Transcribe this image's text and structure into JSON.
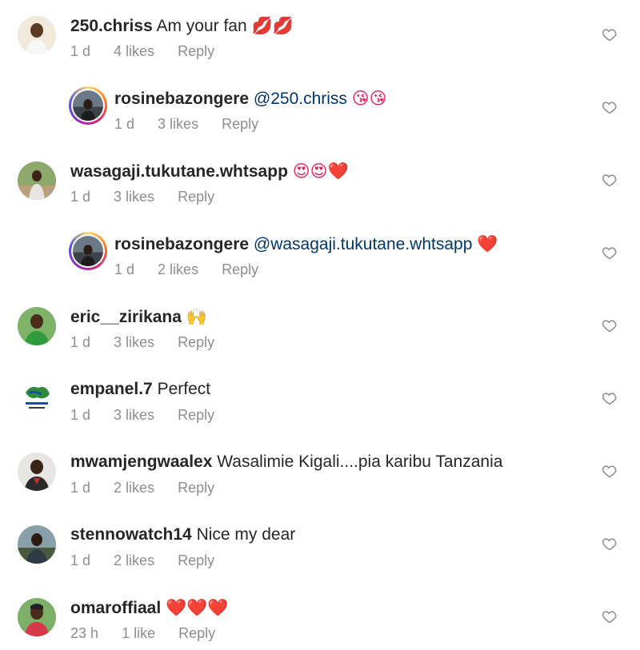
{
  "comments": [
    {
      "username": "250.chriss",
      "text": "Am your fan",
      "emoji": "💋💋",
      "time": "1 d",
      "likes": "4 likes",
      "reply": "Reply"
    },
    {
      "username": "rosinebazongere",
      "mention": "@250.chriss",
      "emoji": "😘😘",
      "time": "1 d",
      "likes": "3 likes",
      "reply": "Reply"
    },
    {
      "username": "wasagaji.tukutane.whtsapp",
      "emoji": "😍😍❤️",
      "time": "1 d",
      "likes": "3 likes",
      "reply": "Reply"
    },
    {
      "username": "rosinebazongere",
      "mention": "@wasagaji.tukutane.whtsapp",
      "emoji": "❤️",
      "time": "1 d",
      "likes": "2 likes",
      "reply": "Reply"
    },
    {
      "username": "eric__zirikana",
      "emoji": "🙌",
      "time": "1 d",
      "likes": "3 likes",
      "reply": "Reply"
    },
    {
      "username": "empanel.7",
      "text": "Perfect",
      "time": "1 d",
      "likes": "3 likes",
      "reply": "Reply"
    },
    {
      "username": "mwamjengwaalex",
      "text": "Wasalimie Kigali....pia karibu Tanzania",
      "time": "1 d",
      "likes": "2 likes",
      "reply": "Reply"
    },
    {
      "username": "stennowatch14",
      "text": "Nice my dear",
      "time": "1 d",
      "likes": "2 likes",
      "reply": "Reply"
    },
    {
      "username": "omaroffiaal",
      "emoji": "❤️❤️❤️",
      "time": "23 h",
      "likes": "1 like",
      "reply": "Reply"
    }
  ],
  "colors": {
    "text": "#262626",
    "meta": "#8e8e8e",
    "mention": "#00376b",
    "heart_outline": "#8e8e8e"
  },
  "icons": {
    "like": "heart-outline-icon"
  }
}
